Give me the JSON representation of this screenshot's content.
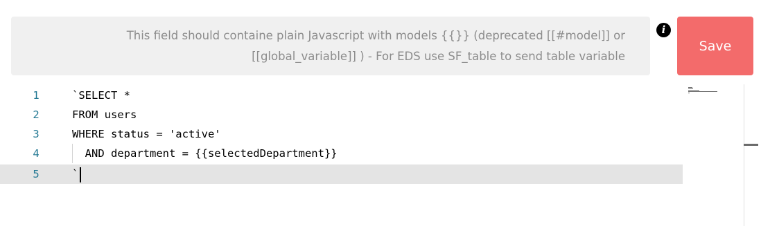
{
  "hint": {
    "line1": "This field should containe plain Javascript with models {{}} (deprecated [[#model]] or",
    "line2": "[[global_variable]] ) - For EDS use SF_table to send table variable"
  },
  "info_icon": {
    "glyph": "i",
    "icon": "info-icon"
  },
  "toolbar": {
    "save_label": "Save"
  },
  "colors": {
    "save_button": "#f36b6b",
    "hint_background": "#f0f0f0",
    "hint_text": "#8c8c8c",
    "line_numbers": "#237893",
    "active_line": "#e4e4e4"
  },
  "editor": {
    "active_line": 5,
    "lines": [
      {
        "number": "1",
        "text": "`SELECT *"
      },
      {
        "number": "2",
        "text": "FROM users"
      },
      {
        "number": "3",
        "text": "WHERE status = 'active'"
      },
      {
        "number": "4",
        "text": "  AND department = {{selectedDepartment}}"
      },
      {
        "number": "5",
        "text": "`"
      }
    ]
  }
}
